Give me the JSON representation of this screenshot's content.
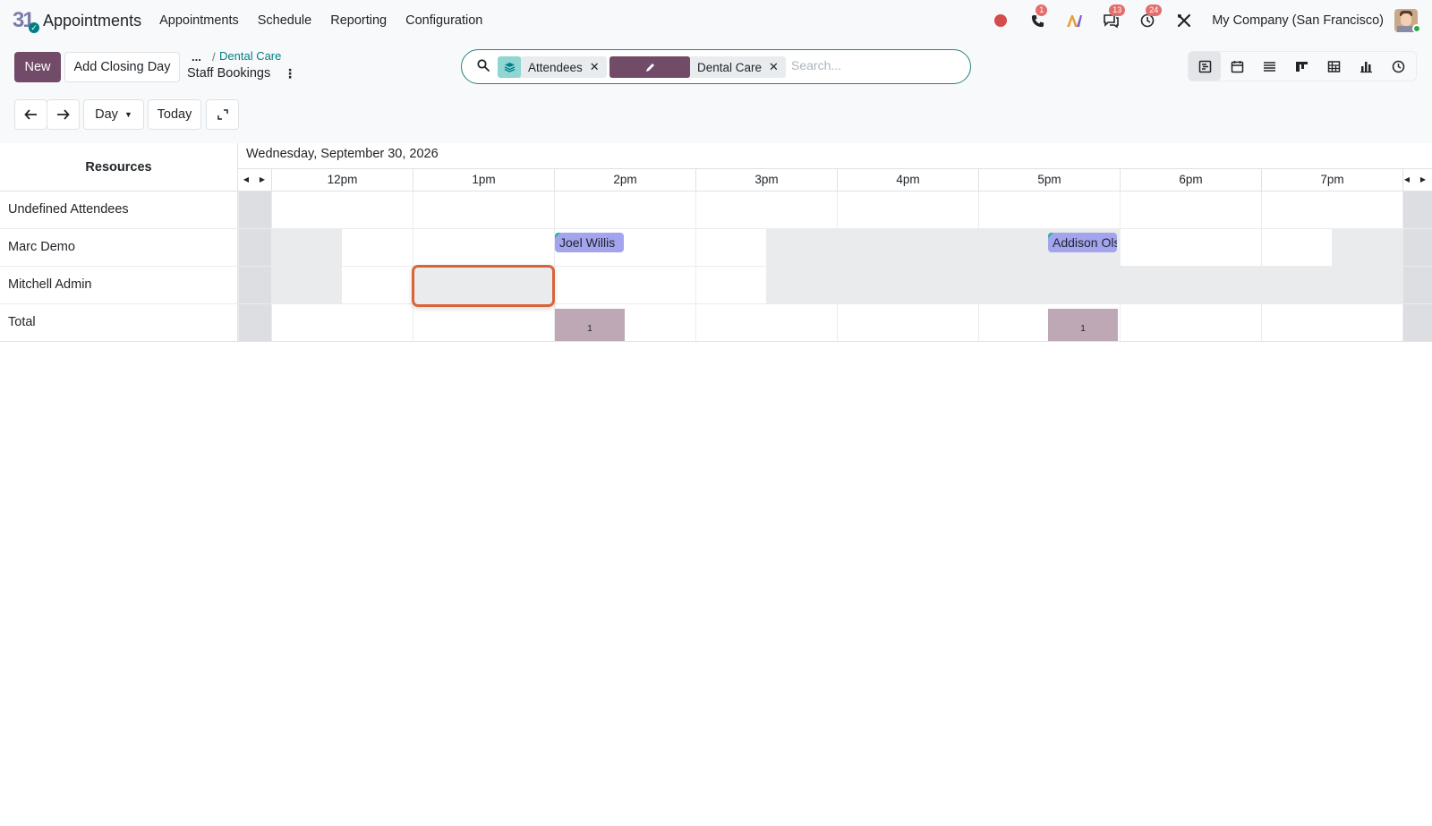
{
  "app": {
    "name": "Appointments"
  },
  "menu": [
    "Appointments",
    "Schedule",
    "Reporting",
    "Configuration"
  ],
  "systray": {
    "calls_badge": "1",
    "messages_badge": "13",
    "activities_badge": "24",
    "company": "My Company (San Francisco)"
  },
  "control": {
    "new_label": "New",
    "add_closing_day_label": "Add Closing Day",
    "breadcrumb_dots": "...",
    "breadcrumb_sep": "/",
    "breadcrumb_parent": "Dental Care",
    "breadcrumb_current": "Staff Bookings",
    "scale_label": "Day",
    "today_label": "Today"
  },
  "search": {
    "facets": [
      {
        "label": "Attendees",
        "icon": "layers-icon"
      },
      {
        "label": "Dental Care",
        "icon": "pencil-icon"
      }
    ],
    "placeholder": "Search..."
  },
  "views": [
    "gantt",
    "calendar",
    "list",
    "kanban",
    "pivot",
    "graph",
    "activity"
  ],
  "gantt": {
    "resources_header": "Resources",
    "date_title": "Wednesday, September 30, 2026",
    "hours": [
      "12pm",
      "1pm",
      "2pm",
      "3pm",
      "4pm",
      "5pm",
      "6pm",
      "7pm"
    ],
    "rows": [
      {
        "label": "Undefined Attendees"
      },
      {
        "label": "Marc Demo"
      },
      {
        "label": "Mitchell Admin"
      },
      {
        "label": "Total"
      }
    ],
    "appointments": [
      {
        "name": "Joel Willis",
        "resource": "Marc Demo",
        "start": "2pm"
      },
      {
        "name": "Addison Olson",
        "resource": "Marc Demo",
        "start": "5pm"
      }
    ],
    "totals": [
      {
        "hour": "2pm",
        "count": "1"
      },
      {
        "hour": "5pm",
        "count": "1"
      }
    ]
  },
  "colors": {
    "primary": "#714b67",
    "accent": "#017e84",
    "pill": "#a3a4ee",
    "total_bar": "#bfa8b6",
    "selection": "#d9643a"
  }
}
